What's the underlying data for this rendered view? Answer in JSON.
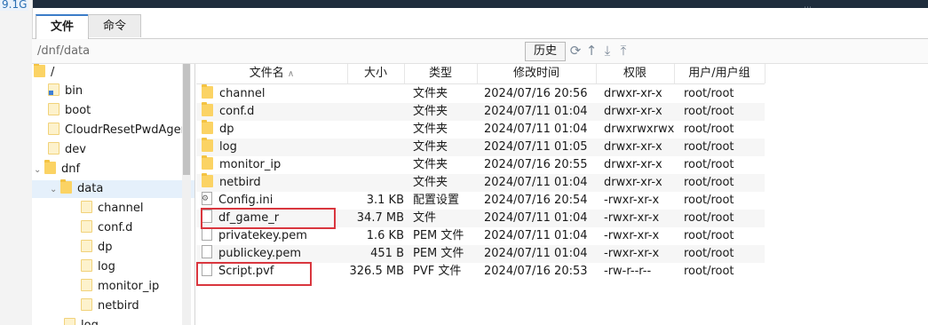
{
  "left_edge_label": "9.1G",
  "tabs": [
    {
      "label": "文件",
      "active": true
    },
    {
      "label": "命令",
      "active": false
    }
  ],
  "path": "/dnf/data",
  "history_label": "历史",
  "tree": [
    {
      "label": "/",
      "level": 0
    },
    {
      "label": "bin",
      "level": 1
    },
    {
      "label": "boot",
      "level": 1
    },
    {
      "label": "CloudrResetPwdAgen",
      "level": 1
    },
    {
      "label": "dev",
      "level": 1
    },
    {
      "label": "dnf",
      "level": 1,
      "expanded": true
    },
    {
      "label": "data",
      "level": 2,
      "expanded": true,
      "selected": true
    },
    {
      "label": "channel",
      "level": 3
    },
    {
      "label": "conf.d",
      "level": 3
    },
    {
      "label": "dp",
      "level": 3
    },
    {
      "label": "log",
      "level": 3
    },
    {
      "label": "monitor_ip",
      "level": 3
    },
    {
      "label": "netbird",
      "level": 3
    },
    {
      "label": "log",
      "level": 2
    }
  ],
  "columns": {
    "name": "文件名",
    "size": "大小",
    "type": "类型",
    "modified": "修改时间",
    "perms": "权限",
    "owner": "用户/用户组"
  },
  "files": [
    {
      "name": "channel",
      "size": "",
      "type": "文件夹",
      "modified": "2024/07/16 20:56",
      "perms": "drwxr-xr-x",
      "owner": "root/root",
      "icon": "folder"
    },
    {
      "name": "conf.d",
      "size": "",
      "type": "文件夹",
      "modified": "2024/07/11 01:04",
      "perms": "drwxr-xr-x",
      "owner": "root/root",
      "icon": "folder"
    },
    {
      "name": "dp",
      "size": "",
      "type": "文件夹",
      "modified": "2024/07/11 01:04",
      "perms": "drwxrwxrwx",
      "owner": "root/root",
      "icon": "folder"
    },
    {
      "name": "log",
      "size": "",
      "type": "文件夹",
      "modified": "2024/07/11 01:05",
      "perms": "drwxr-xr-x",
      "owner": "root/root",
      "icon": "folder"
    },
    {
      "name": "monitor_ip",
      "size": "",
      "type": "文件夹",
      "modified": "2024/07/16 20:55",
      "perms": "drwxr-xr-x",
      "owner": "root/root",
      "icon": "folder"
    },
    {
      "name": "netbird",
      "size": "",
      "type": "文件夹",
      "modified": "2024/07/11 01:04",
      "perms": "drwxr-xr-x",
      "owner": "root/root",
      "icon": "folder"
    },
    {
      "name": "Config.ini",
      "size": "3.1 KB",
      "type": "配置设置",
      "modified": "2024/07/16 20:54",
      "perms": "-rwxr-xr-x",
      "owner": "root/root",
      "icon": "config-file"
    },
    {
      "name": "df_game_r",
      "size": "34.7 MB",
      "type": "文件",
      "modified": "2024/07/11 01:04",
      "perms": "-rwxr-xr-x",
      "owner": "root/root",
      "icon": "file"
    },
    {
      "name": "privatekey.pem",
      "size": "1.6 KB",
      "type": "PEM 文件",
      "modified": "2024/07/11 01:04",
      "perms": "-rwxr-xr-x",
      "owner": "root/root",
      "icon": "file"
    },
    {
      "name": "publickey.pem",
      "size": "451 B",
      "type": "PEM 文件",
      "modified": "2024/07/11 01:04",
      "perms": "-rwxr-xr-x",
      "owner": "root/root",
      "icon": "file"
    },
    {
      "name": "Script.pvf",
      "size": "326.5 MB",
      "type": "PVF 文件",
      "modified": "2024/07/16 20:53",
      "perms": "-rw-r--r--",
      "owner": "root/root",
      "icon": "file"
    }
  ],
  "colors": {
    "highlight": "#d9363e",
    "folder": "#fbd364",
    "active_tab": "#3b7cc8"
  }
}
